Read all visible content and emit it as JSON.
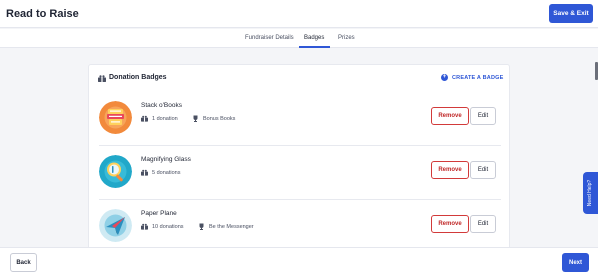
{
  "header": {
    "title": "Read to Raise",
    "save_exit_label": "Save & Exit"
  },
  "tabs": [
    {
      "label": "Fundraiser Details",
      "active": false
    },
    {
      "label": "Badges",
      "active": true
    },
    {
      "label": "Prizes",
      "active": false
    }
  ],
  "card": {
    "title": "Donation Badges",
    "create_label": "CREATE A BADGE",
    "badges": [
      {
        "name": "Stack o'Books",
        "donations": "1 donation",
        "bonus": "Bonus Books",
        "icon": "books-icon",
        "remove_label": "Remove",
        "edit_label": "Edit"
      },
      {
        "name": "Magnifying Glass",
        "donations": "5 donations",
        "bonus": "",
        "icon": "magnifying-glass-icon",
        "remove_label": "Remove",
        "edit_label": "Edit"
      },
      {
        "name": "Paper Plane",
        "donations": "10 donations",
        "bonus": "Be the Messenger",
        "icon": "paper-plane-icon",
        "remove_label": "Remove",
        "edit_label": "Edit"
      }
    ]
  },
  "help": {
    "label": "Need Help?"
  },
  "footer": {
    "back_label": "Back",
    "next_label": "Next"
  },
  "colors": {
    "primary": "#2f57d6",
    "danger": "#d23a3a"
  }
}
